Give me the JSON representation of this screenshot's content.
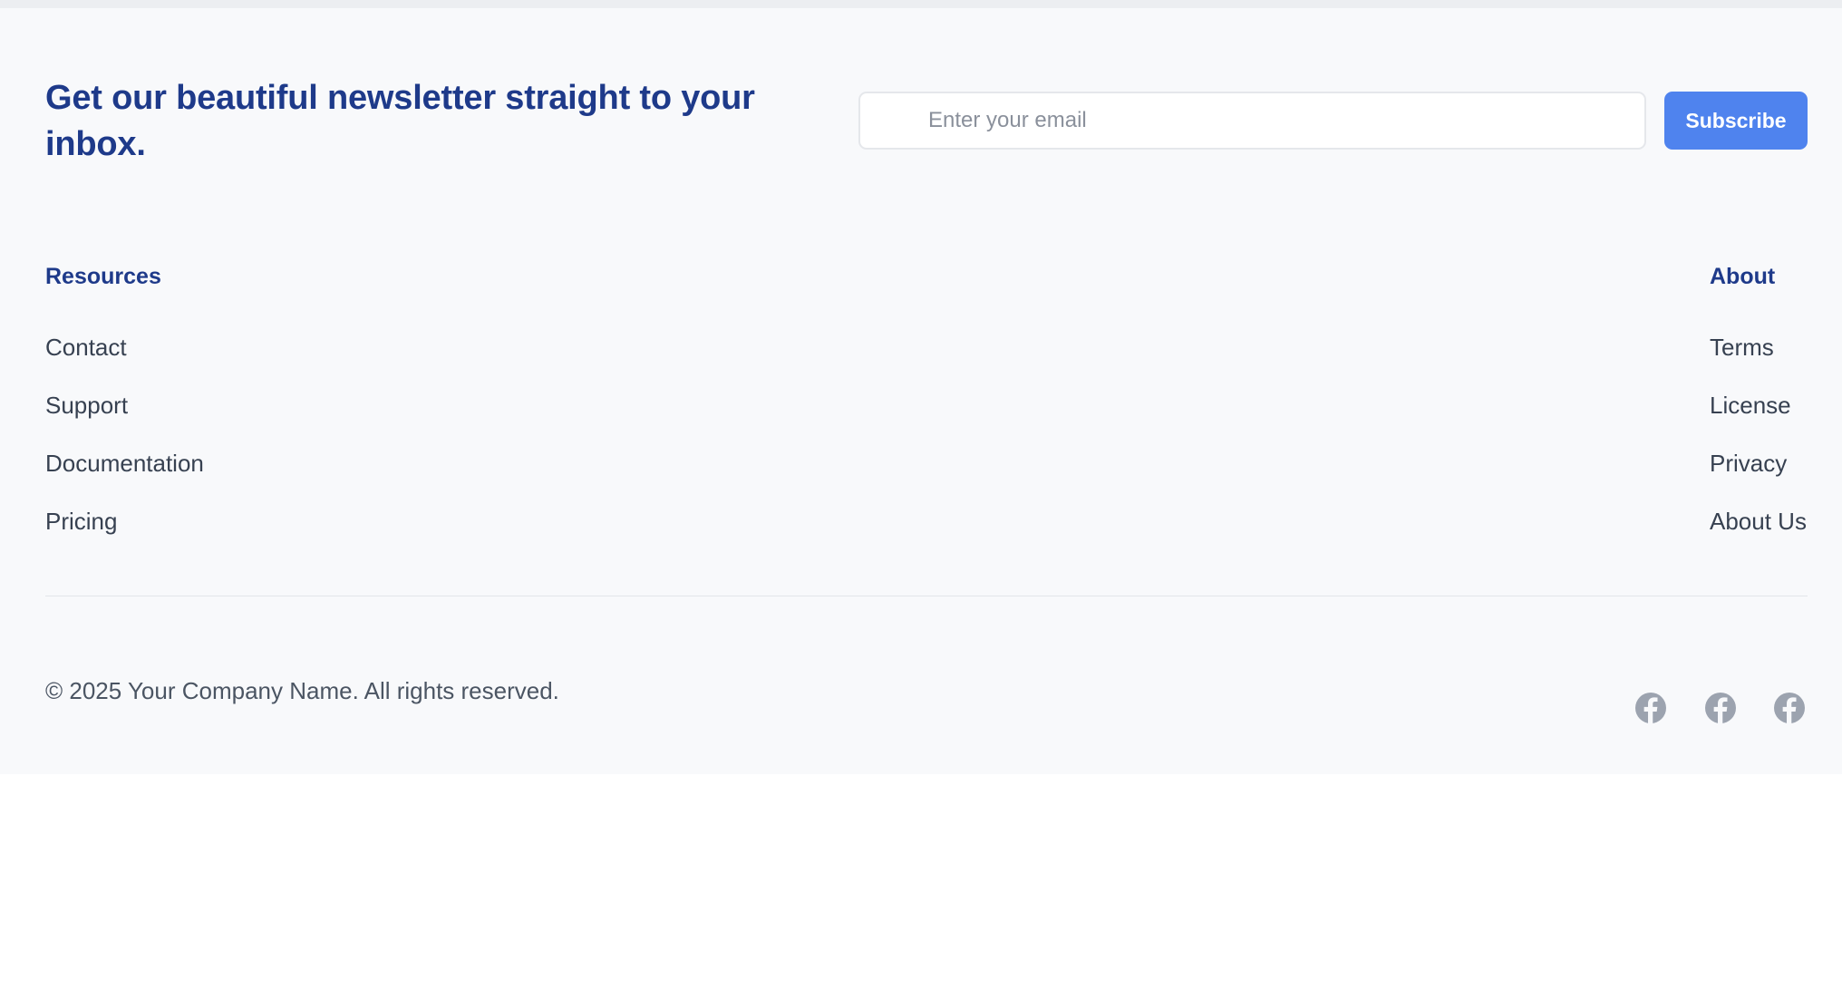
{
  "newsletter": {
    "heading": "Get our beautiful newsletter straight to your inbox.",
    "email_placeholder": "Enter your email",
    "email_value": "",
    "subscribe_label": "Subscribe"
  },
  "resources": {
    "heading": "Resources",
    "links": [
      "Contact",
      "Support",
      "Documentation",
      "Pricing"
    ]
  },
  "about": {
    "heading": "About",
    "links": [
      "Terms",
      "License",
      "Privacy",
      "About Us"
    ]
  },
  "bottom": {
    "copyright": "© 2025 Your Company Name. All rights reserved.",
    "social_icons": [
      "facebook-icon",
      "facebook-icon",
      "facebook-icon"
    ]
  },
  "colors": {
    "heading": "#1e3a8a",
    "accent": "#4f83ee",
    "footer_bg": "#f8f9fb",
    "link_text": "#374151",
    "icon": "#9ca3af"
  }
}
